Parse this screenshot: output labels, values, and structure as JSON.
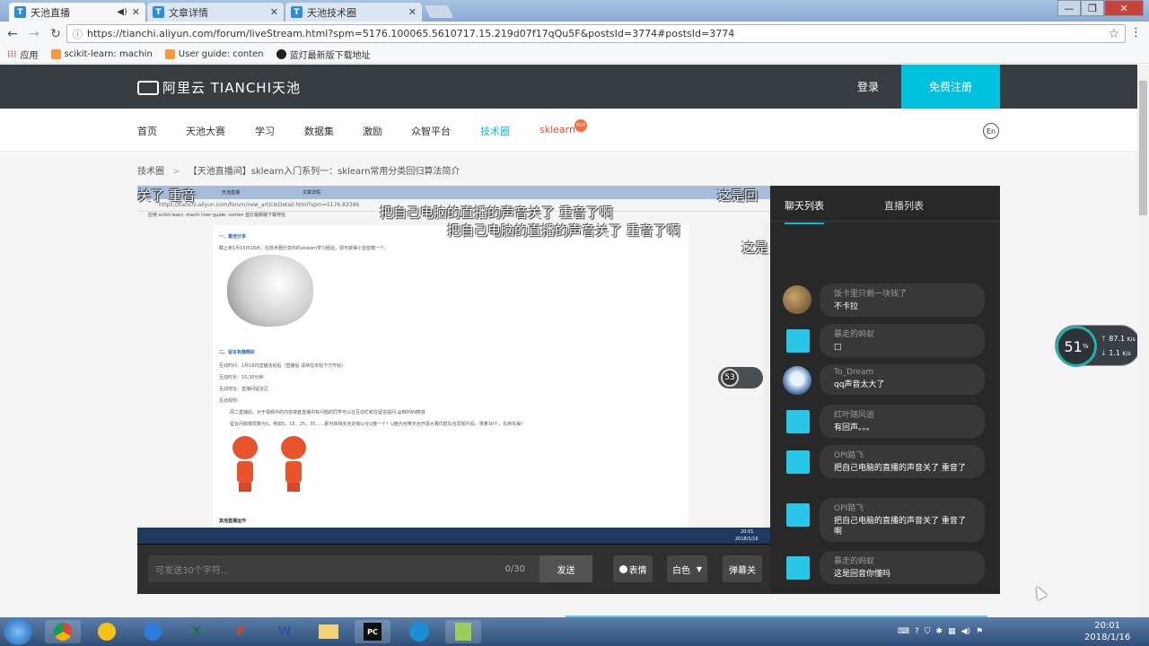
{
  "browser": {
    "tabs": [
      {
        "title": "天池直播",
        "icon": "T"
      },
      {
        "title": "文章详情",
        "icon": "T"
      },
      {
        "title": "天池技术圈",
        "icon": "T"
      }
    ],
    "url": "https://tianchi.aliyun.com/forum/liveStream.html?spm=5176.100065.5610717.15.219d07f17qQu5F&postsId=3774#postsId=3774",
    "bookmarks": [
      "应用",
      "scikit-learn: machin",
      "User guide: conten",
      "蓝灯最新版下载地址"
    ]
  },
  "site": {
    "logo_text": "阿里云 TIANCHI天池",
    "login": "登录",
    "register": "免费注册",
    "nav": [
      "首页",
      "天池大赛",
      "学习",
      "数据集",
      "激励",
      "众智平台",
      "技术圈",
      "sklearn"
    ],
    "hot_badge": "HOT",
    "lang_icon": "En"
  },
  "breadcrumb": {
    "root": "技术圈",
    "sep": ">",
    "title": "【天池直播间】sklearn入门系列一：sklearn常用分类回归算法简介"
  },
  "video": {
    "danmu": [
      "关了 重音",
      "这是回",
      "把自己电脑的直播的声音关了 重音了啊",
      "把自己电脑的直播的声音关了 重音了啊",
      "这是"
    ],
    "inner_tabs": [
      "天池直播",
      "文章详情"
    ],
    "inner_url": "https://tianchi.aliyun.com/forum/new_articleDetail.html?spm=5176.83386",
    "inner_bookmarks": "应用   scikit-learn: machi   User guide: conten   蓝灯最新版下载地址",
    "inner_lines": [
      "一、最佳分享",
      "截止到1月15日18点，在技术圈分享你的sklearn学习经验，即可获得小音音箱一个。",
      "二、留言有趣精彩",
      "互动时间：1月16日直播活动后（直播后 请持在本帖下方开始）",
      "互动时长：15-30分钟",
      "互动地址：直播间留言区",
      "互动规则：",
      "周二直播后，对于视频中的内容或者直播中有问题的同学可以在互动栏和在留言提问 @BRYAN丽苔",
      "留言问题楼层数为5，例如5，15，25，35……即可获得天池定制公仔U盘一个！U盘内含带天池开源大赛优胜队伍原题代码，限量30个，先到先得！",
      "其他直播运作"
    ],
    "meter": "53",
    "inner_clock": "20:01",
    "inner_date": "2018/1/16"
  },
  "controls": {
    "placeholder": "可发送30个字符...",
    "count": "0/30",
    "send": "发送",
    "emoji": "表情",
    "color": "白色",
    "danmu_toggle": "弹幕关"
  },
  "chat": {
    "tabs": [
      "聊天列表",
      "直播列表"
    ],
    "messages": [
      {
        "name": "饭卡里只剩一块钱了",
        "text": "不卡拉",
        "avatar": "photo"
      },
      {
        "name": "暴走的蚂蚁",
        "text": "□",
        "avatar": "default"
      },
      {
        "name": "To_Dream",
        "text": "qq声音太大了",
        "avatar": "photo2"
      },
      {
        "name": "红叶随风逝",
        "text": "有回声。。。",
        "avatar": "default"
      },
      {
        "name": "OPI踏飞",
        "text": "把自己电脑的直播的声音关了 重音了",
        "avatar": "default"
      },
      {
        "name": "OPI踏飞",
        "text": "把自己电脑的直播的声音关了 重音了啊",
        "avatar": "default"
      },
      {
        "name": "暴走的蚂蚁",
        "text": "这是回音你懂吗",
        "avatar": "default"
      }
    ]
  },
  "net_meter": {
    "percent": "51",
    "unit": "%",
    "up": "87.1",
    "down": "1.1",
    "speed_unit": "K/s"
  },
  "taskbar": {
    "time": "20:01",
    "date": "2018/1/16"
  }
}
